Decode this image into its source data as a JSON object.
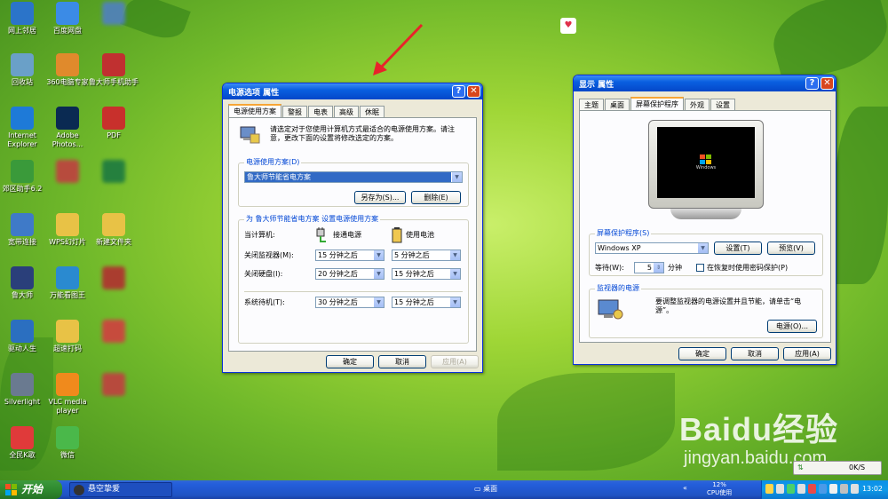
{
  "desktop_icons": [
    {
      "label": "网上邻居",
      "icon": "network-icon",
      "color": "#2b74c9"
    },
    {
      "label": "百度网盘",
      "icon": "cloud-icon",
      "color": "#3b8be6"
    },
    {
      "label": "",
      "icon": "app-icon",
      "color": "#5080c0"
    },
    {
      "label": "回收站",
      "icon": "recycle-bin-icon",
      "color": "#6aa0c8"
    },
    {
      "label": "360电脑专家",
      "icon": "person-icon",
      "color": "#e08a2c"
    },
    {
      "label": "鲁大师手机助手",
      "icon": "phone-icon",
      "color": "#c03030"
    },
    {
      "label": "Internet Explorer",
      "icon": "ie-icon",
      "color": "#1e7ad8"
    },
    {
      "label": "Adobe Photos...",
      "icon": "photoshop-icon",
      "color": "#0a2a52"
    },
    {
      "label": "PDF",
      "icon": "pdf-icon",
      "color": "#c8302c"
    },
    {
      "label": "郊区助手6.2",
      "icon": "game-icon",
      "color": "#3a9a3a"
    },
    {
      "label": "",
      "icon": "app-icon",
      "color": "#c04040"
    },
    {
      "label": "",
      "icon": "excel-icon",
      "color": "#1d7a40"
    },
    {
      "label": "宽带连接",
      "icon": "broadband-icon",
      "color": "#3f7ac8"
    },
    {
      "label": "WPS幻灯片",
      "icon": "folder-icon",
      "color": "#e8c246"
    },
    {
      "label": "新建文件夹",
      "icon": "folder-icon",
      "color": "#e8c246"
    },
    {
      "label": "鲁大师",
      "icon": "ludashi-icon",
      "color": "#2a3f7a"
    },
    {
      "label": "万能看图王",
      "icon": "eye-icon",
      "color": "#2a8ad0"
    },
    {
      "label": "",
      "icon": "app-icon",
      "color": "#b03030"
    },
    {
      "label": "驱动人生",
      "icon": "gear-icon",
      "color": "#2b6fc0"
    },
    {
      "label": "超速打码",
      "icon": "folder-icon",
      "color": "#e8c246"
    },
    {
      "label": "",
      "icon": "file-icon",
      "color": "#d04040"
    },
    {
      "label": "Silverlight",
      "icon": "window-icon",
      "color": "#6a7a90"
    },
    {
      "label": "VLC media player",
      "icon": "vlc-icon",
      "color": "#f08a1c"
    },
    {
      "label": "",
      "icon": "file-icon",
      "color": "#c04040"
    },
    {
      "label": "全民K歌",
      "icon": "kge-icon",
      "color": "#e03a3a"
    },
    {
      "label": "微信",
      "icon": "wechat-icon",
      "color": "#4ab84a"
    }
  ],
  "power_dialog": {
    "title": "电源选项 属性",
    "help": "?",
    "close": "✕",
    "tabs": [
      "电源使用方案",
      "警报",
      "电表",
      "高级",
      "休眠"
    ],
    "intro": "请选定对于您使用计算机方式最适合的电源使用方案。请注意，更改下面的设置将修改选定的方案。",
    "scheme_group": "电源使用方案(D)",
    "scheme_value": "鲁大师节能省电方案",
    "save_as": "另存为(S)...",
    "delete": "删除(E)",
    "settings_group": "为 鲁大师节能省电方案 设置电源使用方案",
    "when_computer": "当计算机:",
    "plugged_in": "接通电源",
    "on_battery": "使用电池",
    "rows": [
      {
        "label": "关闭监视器(M):",
        "ac": "15 分钟之后",
        "dc": "5 分钟之后"
      },
      {
        "label": "关闭硬盘(I):",
        "ac": "20 分钟之后",
        "dc": "15 分钟之后"
      },
      {
        "label": "系统待机(T):",
        "ac": "30 分钟之后",
        "dc": "15 分钟之后"
      }
    ],
    "ok": "确定",
    "cancel": "取消",
    "apply": "应用(A)"
  },
  "display_dialog": {
    "title": "显示 属性",
    "help": "?",
    "close": "✕",
    "tabs": [
      "主题",
      "桌面",
      "屏幕保护程序",
      "外观",
      "设置"
    ],
    "monitor_text": "Windows",
    "screensaver_group": "屏幕保护程序(S)",
    "screensaver_value": "Windows XP",
    "settings": "设置(T)",
    "preview": "预览(V)",
    "wait_label": "等待(W):",
    "wait_value": "5",
    "minutes": "分钟",
    "password_label": "在恢复时使用密码保护(P)",
    "monitor_power_group": "监视器的电源",
    "monitor_power_text": "要调整监视器的电源设置并且节能，请单击“电源”。",
    "power_button": "电源(O)...",
    "ok": "确定",
    "cancel": "取消",
    "apply": "应用(A)"
  },
  "taskbar": {
    "start": "开始",
    "task_item": "悬空挚爱",
    "desktop_label": "桌面",
    "cpu_percent": "12%",
    "cpu_label": "CPU使用",
    "clock": "13:02"
  },
  "net_widget": {
    "speed": "0K/S"
  },
  "watermark": {
    "brand": "Baidu经验",
    "url": "jingyan.baidu.com"
  }
}
